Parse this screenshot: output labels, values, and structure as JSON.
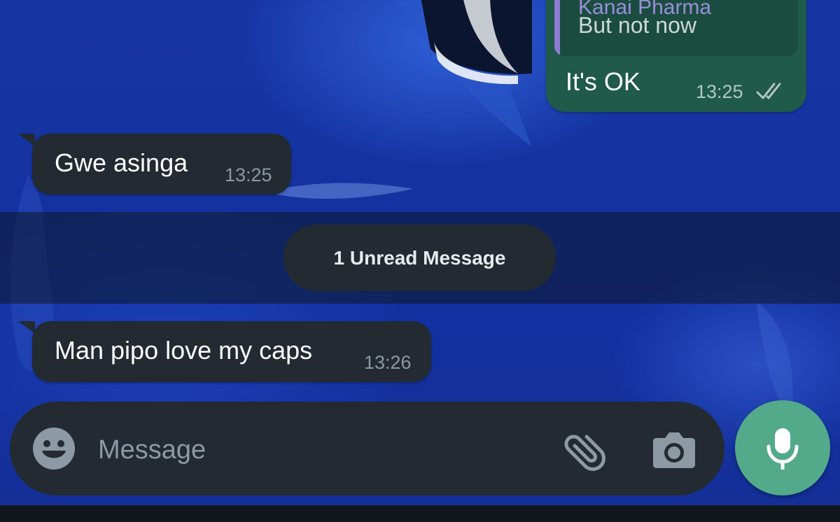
{
  "colors": {
    "incoming_bubble": "#232a31",
    "outgoing_bubble": "#1f5a4a",
    "accent_mic": "#52aa8a",
    "quote_bar": "#8e7bd6",
    "timestamp": "#8c98a2"
  },
  "outgoing": {
    "quote_author": "Kanai Pharma",
    "quote_text": "But not now",
    "text": "It's OK",
    "time": "13:25",
    "status_icon": "double-check-icon"
  },
  "messages": [
    {
      "text": "Gwe asinga",
      "time": "13:25"
    },
    {
      "text": "Man pipo love my caps",
      "time": "13:26"
    }
  ],
  "unread_divider": {
    "label": "1 Unread Message"
  },
  "composer": {
    "placeholder": "Message",
    "emoji_icon": "emoji-icon",
    "attach_icon": "paperclip-icon",
    "camera_icon": "camera-icon",
    "mic_icon": "microphone-icon"
  }
}
